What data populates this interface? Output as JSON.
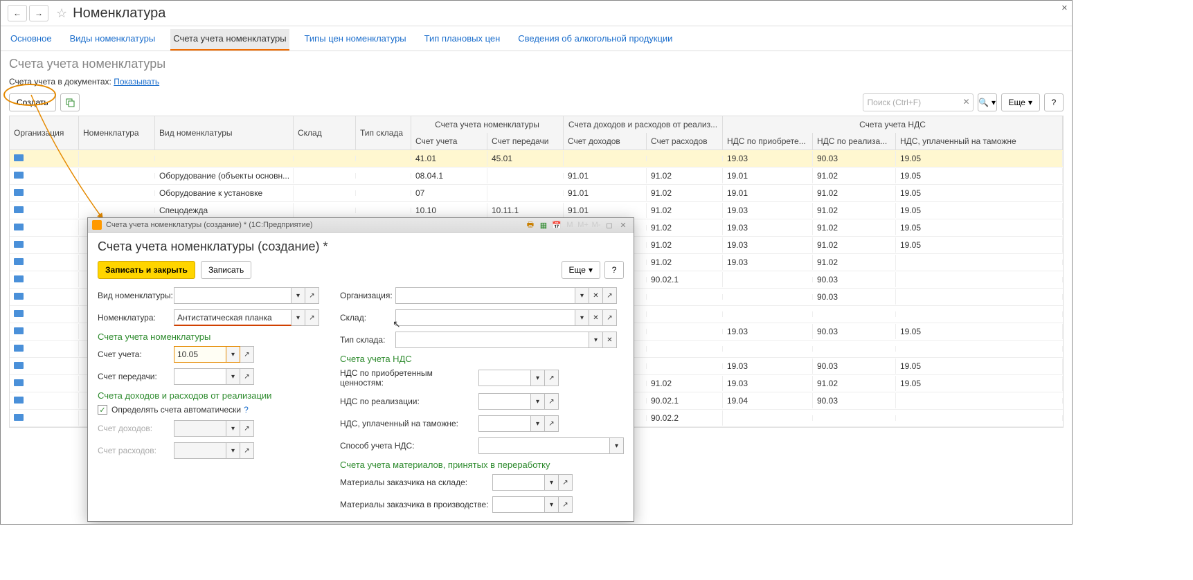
{
  "header": {
    "title": "Номенклатура"
  },
  "tabs": [
    "Основное",
    "Виды номенклатуры",
    "Счета учета номенклатуры",
    "Типы цен номенклатуры",
    "Тип плановых цен",
    "Сведения об алкогольной продукции"
  ],
  "active_tab": 2,
  "subtitle": "Счета учета номенклатуры",
  "docline": {
    "label": "Счета учета в документах:",
    "link": "Показывать"
  },
  "toolbar": {
    "create": "Создать",
    "search_ph": "Поиск (Ctrl+F)",
    "more": "Еще",
    "help": "?"
  },
  "columns": {
    "org": "Организация",
    "nom": "Номенклатура",
    "type": "Вид номенклатуры",
    "wh": "Склад",
    "wht": "Тип склада",
    "grp_nom": "Счета учета номенклатуры",
    "acct": "Счет учета",
    "trans": "Счет передачи",
    "grp_real": "Счета доходов и расходов от реализ...",
    "inc": "Счет доходов",
    "exp": "Счет расходов",
    "grp_vat": "Счета учета НДС",
    "vat1": "НДС по приобрете...",
    "vat2": "НДС по реализа...",
    "vat3": "НДС, уплаченный на таможне"
  },
  "rows": [
    {
      "type": "",
      "acct": "41.01",
      "trans": "45.01",
      "inc": "",
      "exp": "",
      "v1": "19.03",
      "v2": "90.03",
      "v3": "19.05",
      "hl": true
    },
    {
      "type": "Оборудование (объекты основн...",
      "acct": "08.04.1",
      "trans": "",
      "inc": "91.01",
      "exp": "91.02",
      "v1": "19.01",
      "v2": "91.02",
      "v3": "19.05"
    },
    {
      "type": "Оборудование к установке",
      "acct": "07",
      "trans": "",
      "inc": "91.01",
      "exp": "91.02",
      "v1": "19.01",
      "v2": "91.02",
      "v3": "19.05"
    },
    {
      "type": "Спецодежда",
      "acct": "10.10",
      "trans": "10.11.1",
      "inc": "91.01",
      "exp": "91.02",
      "v1": "19.03",
      "v2": "91.02",
      "v3": "19.05"
    },
    {
      "type": "",
      "acct": "",
      "trans": "",
      "inc": "",
      "exp": "91.02",
      "v1": "19.03",
      "v2": "91.02",
      "v3": "19.05"
    },
    {
      "type": "",
      "acct": "",
      "trans": "",
      "inc": "",
      "exp": "91.02",
      "v1": "19.03",
      "v2": "91.02",
      "v3": "19.05"
    },
    {
      "type": "",
      "acct": "",
      "trans": "",
      "inc": "",
      "exp": "91.02",
      "v1": "19.03",
      "v2": "91.02",
      "v3": ""
    },
    {
      "type": "",
      "acct": "",
      "trans": "",
      "inc": "",
      "exp": "90.02.1",
      "v1": "",
      "v2": "90.03",
      "v3": ""
    },
    {
      "type": "",
      "acct": "",
      "trans": "",
      "inc": "",
      "exp": "",
      "v1": "",
      "v2": "90.03",
      "v3": ""
    },
    {
      "type": "",
      "acct": "",
      "trans": "",
      "inc": "",
      "exp": "",
      "v1": "",
      "v2": "",
      "v3": ""
    },
    {
      "type": "",
      "acct": "",
      "trans": "",
      "inc": "",
      "exp": "",
      "v1": "19.03",
      "v2": "90.03",
      "v3": "19.05"
    },
    {
      "type": "",
      "acct": "",
      "trans": "",
      "inc": "",
      "exp": "",
      "v1": "",
      "v2": "",
      "v3": ""
    },
    {
      "type": "",
      "acct": "",
      "trans": "",
      "inc": "",
      "exp": "",
      "v1": "19.03",
      "v2": "90.03",
      "v3": "19.05"
    },
    {
      "type": "",
      "acct": "",
      "trans": "",
      "inc": "",
      "exp": "91.02",
      "v1": "19.03",
      "v2": "91.02",
      "v3": "19.05"
    },
    {
      "type": "",
      "acct": "",
      "trans": "",
      "inc": "",
      "exp": "90.02.1",
      "v1": "19.04",
      "v2": "90.03",
      "v3": ""
    },
    {
      "type": "",
      "acct": "",
      "trans": "",
      "inc": "",
      "exp": "90.02.2",
      "v1": "",
      "v2": "",
      "v3": ""
    }
  ],
  "dialog": {
    "wintitle": "Счета учета номенклатуры (создание) *  (1С:Предприятие)",
    "h1": "Счета учета номенклатуры (создание) *",
    "save_close": "Записать и закрыть",
    "save": "Записать",
    "more": "Еще",
    "help": "?",
    "labels": {
      "vid": "Вид номенклатуры:",
      "nom": "Номенклатура:",
      "org": "Организация:",
      "wh": "Склад:",
      "wht": "Тип склада:",
      "sec_nom": "Счета учета номенклатуры",
      "acct": "Счет учета:",
      "trans": "Счет передачи:",
      "sec_vat": "Счета учета НДС",
      "vat_acq": "НДС по приобретенным ценностям:",
      "vat_real": "НДС по реализации:",
      "vat_cust": "НДС, уплаченный на таможне:",
      "vat_method": "Способ учета НДС:",
      "sec_real": "Счета доходов и расходов от реализации",
      "auto": "Определять счета автоматически",
      "inc": "Счет доходов:",
      "exp": "Счет расходов:",
      "sec_mat": "Счета учета материалов, принятых в переработку",
      "mat_wh": "Материалы заказчика на складе:",
      "mat_prod": "Материалы заказчика в производстве:"
    },
    "values": {
      "nom": "Антистатическая планка",
      "acct": "10.05"
    },
    "winbtns": {
      "m": "M",
      "mminus": "M-",
      "mplus": "M+"
    }
  }
}
